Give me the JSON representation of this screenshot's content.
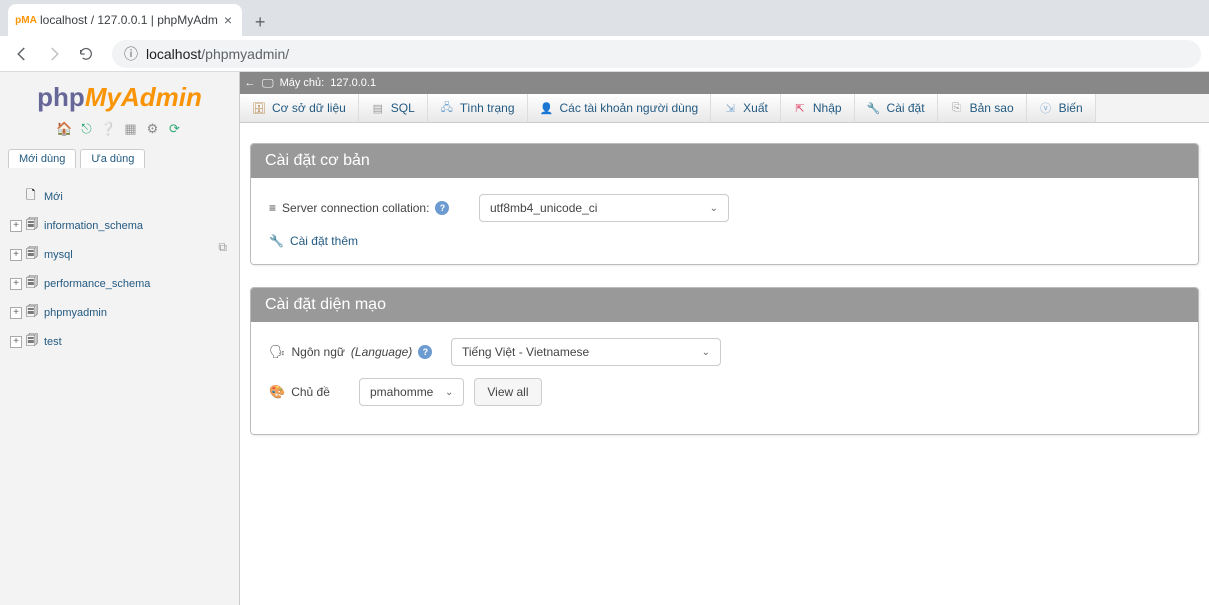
{
  "browser": {
    "tab_title": "localhost / 127.0.0.1 | phpMyAdm",
    "url_prefix": "localhost",
    "url_path": "/phpmyadmin/"
  },
  "logo": {
    "php": "php",
    "my": "My",
    "admin": "Admin"
  },
  "sidebar": {
    "tabs": {
      "recent": "Mới dùng",
      "favorites": "Ưa dùng"
    },
    "new_label": "Mới",
    "databases": [
      "information_schema",
      "mysql",
      "performance_schema",
      "phpmyadmin",
      "test"
    ]
  },
  "breadcrumb": {
    "server_label": "Máy chủ:",
    "server_value": "127.0.0.1"
  },
  "tabs": {
    "databases": "Cơ sở dữ liệu",
    "sql": "SQL",
    "status": "Tình trạng",
    "users": "Các tài khoản người dùng",
    "export": "Xuất",
    "import": "Nhập",
    "settings": "Cài đặt",
    "replication": "Bản sao",
    "variables": "Biến"
  },
  "panel_general": {
    "title": "Cài đặt cơ bản",
    "collation_label": "Server connection collation:",
    "collation_value": "utf8mb4_unicode_ci",
    "more_settings": "Cài đặt thêm"
  },
  "panel_appearance": {
    "title": "Cài đặt diện mạo",
    "language_label": "Ngôn ngữ",
    "language_label_en": "(Language)",
    "language_value": "Tiếng Việt - Vietnamese",
    "theme_label": "Chủ đề",
    "theme_value": "pmahomme",
    "view_all": "View all"
  }
}
